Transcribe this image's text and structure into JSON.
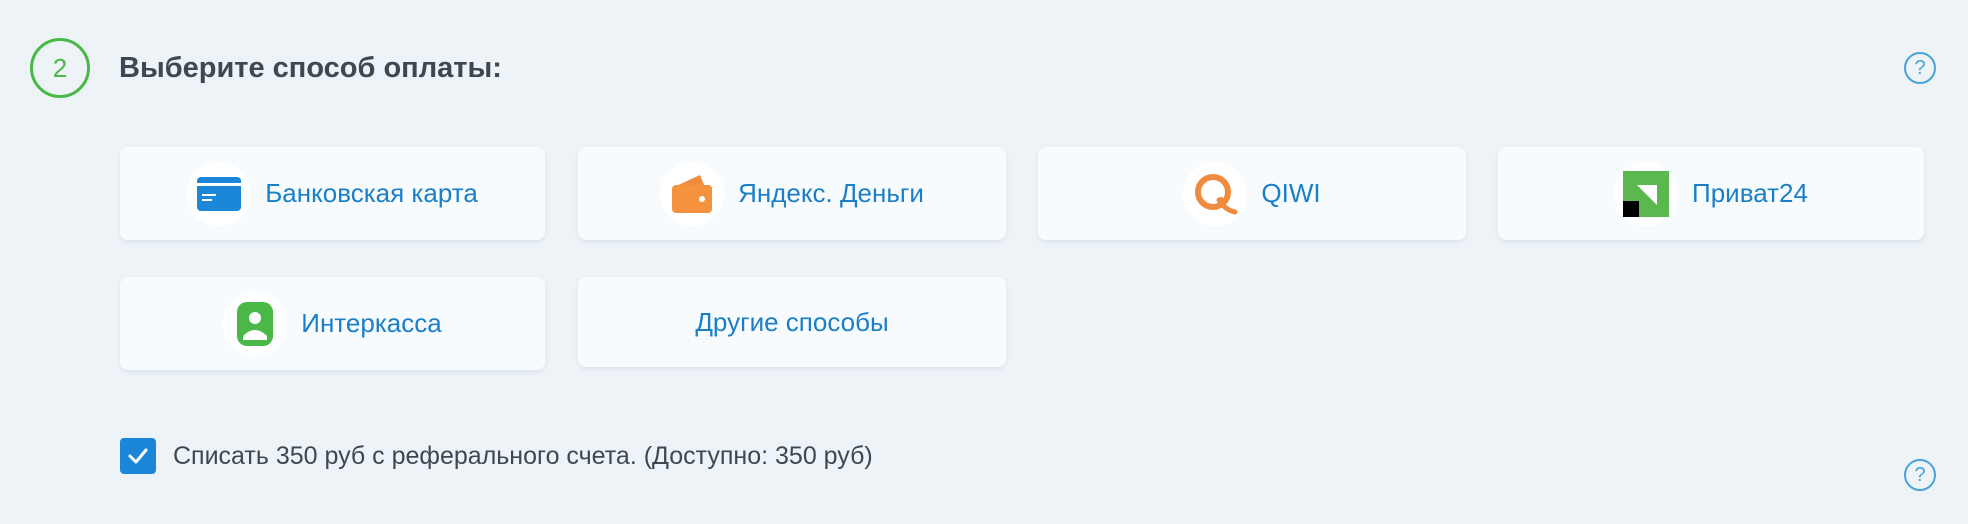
{
  "step": {
    "number": "2",
    "title": "Выберите способ оплаты:"
  },
  "help": {
    "glyph": "?"
  },
  "payment_methods": [
    {
      "label": "Банковская карта",
      "icon": "bank-card-icon"
    },
    {
      "label": "Яндекс. Деньги",
      "icon": "yandex-money-wallet-icon"
    },
    {
      "label": "QIWI",
      "icon": "qiwi-icon"
    },
    {
      "label": "Приват24",
      "icon": "privat24-icon"
    },
    {
      "label": "Интеркасса",
      "icon": "interkassa-icon"
    },
    {
      "label": "Другие способы",
      "icon": ""
    }
  ],
  "referral": {
    "checked": true,
    "text": "Списать 350 руб с реферального счета. (Доступно: 350 руб)"
  },
  "colors": {
    "accent_green": "#4ab847",
    "link_blue": "#1a7fc7",
    "checkbox_blue": "#1c86d9",
    "background": "#eef3f8"
  }
}
